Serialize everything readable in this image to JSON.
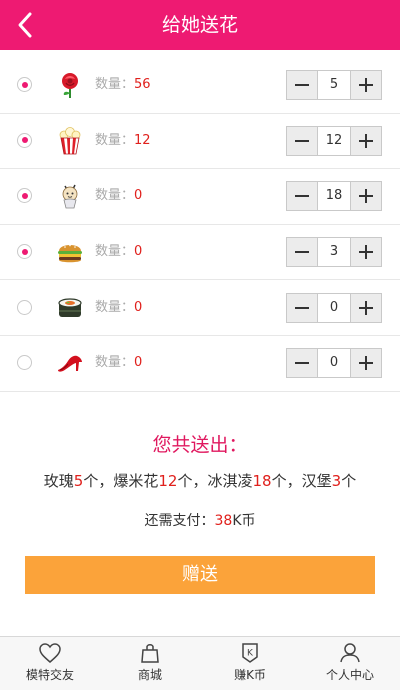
{
  "header": {
    "title": "给她送花"
  },
  "gifts": [
    {
      "name": "rose",
      "qty_label": "数量：",
      "qty": "56",
      "selected": true,
      "count": "5"
    },
    {
      "name": "popcorn",
      "qty_label": "数量：",
      "qty": "12",
      "selected": true,
      "count": "12"
    },
    {
      "name": "icecream",
      "qty_label": "数量：",
      "qty": "0",
      "selected": true,
      "count": "18"
    },
    {
      "name": "burger",
      "qty_label": "数量：",
      "qty": "0",
      "selected": true,
      "count": "3"
    },
    {
      "name": "sushi",
      "qty_label": "数量：",
      "qty": "0",
      "selected": false,
      "count": "0"
    },
    {
      "name": "high-heel",
      "qty_label": "数量：",
      "qty": "0",
      "selected": false,
      "count": "0"
    }
  ],
  "summary": {
    "title": "您共送出：",
    "items": [
      {
        "name": "玫瑰",
        "count": "5",
        "unit": "个"
      },
      {
        "name": "爆米花",
        "count": "12",
        "unit": "个"
      },
      {
        "name": "冰淇凌",
        "count": "18",
        "unit": "个"
      },
      {
        "name": "汉堡",
        "count": "3",
        "unit": "个"
      }
    ],
    "sep": "，",
    "pay_prefix": "还需支付：",
    "pay_amount": "38",
    "pay_suffix": "K币"
  },
  "action": {
    "label": "赠送"
  },
  "tabbar": [
    {
      "label": "模特交友",
      "icon": "heart-icon"
    },
    {
      "label": "商城",
      "icon": "bag-icon"
    },
    {
      "label": "赚K币",
      "icon": "k-coin-icon"
    },
    {
      "label": "个人中心",
      "icon": "user-icon"
    }
  ],
  "colors": {
    "brand": "#ee1a72",
    "accent": "#fba33a",
    "number": "#e0201c"
  }
}
